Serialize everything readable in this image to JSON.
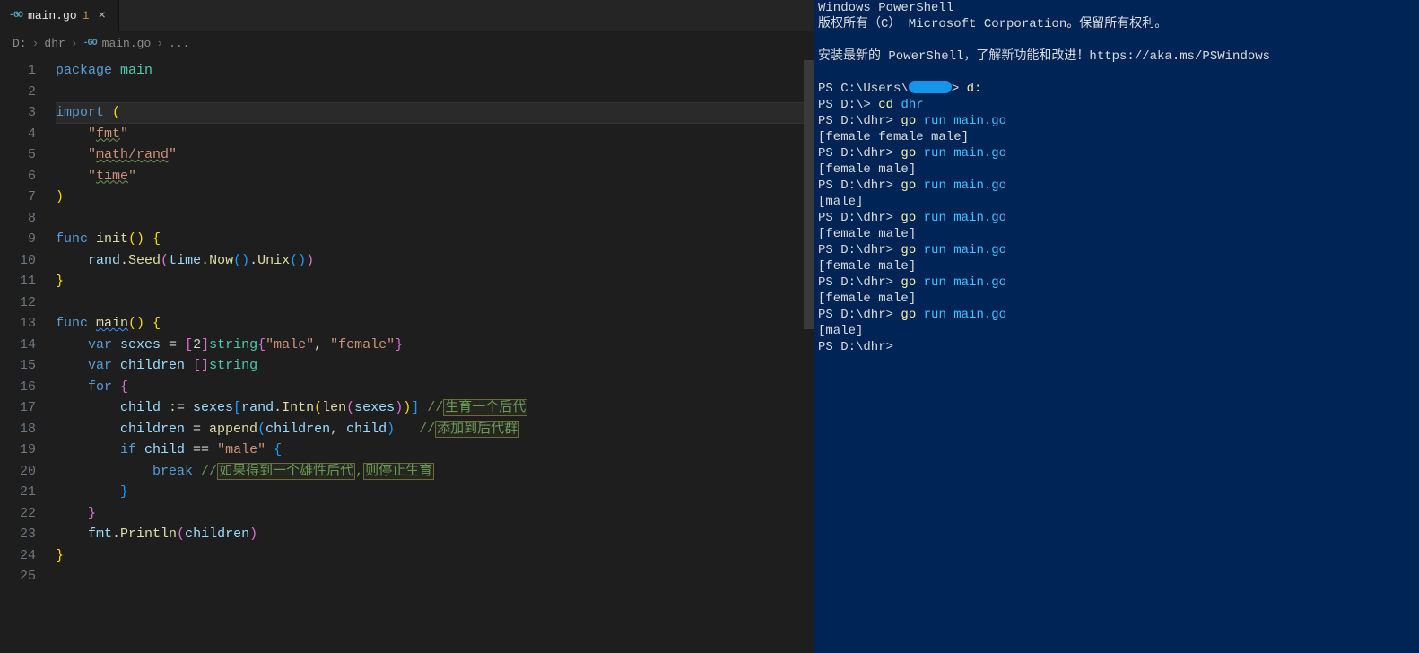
{
  "tab": {
    "filename": "main.go",
    "badge": "1",
    "icon_label": "-GO",
    "close_glyph": "×"
  },
  "breadcrumbs": {
    "parts": [
      "D:",
      "dhr",
      "main.go",
      "..."
    ],
    "sep": "›",
    "go_icon_label": "-GO"
  },
  "editor": {
    "highlight_line_index": 2,
    "lines": [
      [
        {
          "t": "package ",
          "c": "kw"
        },
        {
          "t": "main",
          "c": "ty"
        }
      ],
      [
        {
          "t": "",
          "c": "punc"
        }
      ],
      [
        {
          "t": "import ",
          "c": "kw"
        },
        {
          "t": "(",
          "c": "brk-gold"
        }
      ],
      [
        {
          "t": "    ",
          "c": "punc"
        },
        {
          "t": "\"",
          "c": "str"
        },
        {
          "t": "fmt",
          "c": "str squiggle-grn"
        },
        {
          "t": "\"",
          "c": "str"
        }
      ],
      [
        {
          "t": "    ",
          "c": "punc"
        },
        {
          "t": "\"",
          "c": "str"
        },
        {
          "t": "math/rand",
          "c": "str squiggle-grn"
        },
        {
          "t": "\"",
          "c": "str"
        }
      ],
      [
        {
          "t": "    ",
          "c": "punc"
        },
        {
          "t": "\"",
          "c": "str"
        },
        {
          "t": "time",
          "c": "str squiggle-grn"
        },
        {
          "t": "\"",
          "c": "str"
        }
      ],
      [
        {
          "t": ")",
          "c": "brk-gold"
        }
      ],
      [
        {
          "t": "",
          "c": "punc"
        }
      ],
      [
        {
          "t": "func ",
          "c": "kw"
        },
        {
          "t": "init",
          "c": "fn"
        },
        {
          "t": "() ",
          "c": "brk-gold"
        },
        {
          "t": "{",
          "c": "brk-gold"
        }
      ],
      [
        {
          "t": "    rand",
          "c": "ident"
        },
        {
          "t": ".",
          "c": "punc"
        },
        {
          "t": "Seed",
          "c": "fn"
        },
        {
          "t": "(",
          "c": "brk-pink"
        },
        {
          "t": "time",
          "c": "ident"
        },
        {
          "t": ".",
          "c": "punc"
        },
        {
          "t": "Now",
          "c": "fn"
        },
        {
          "t": "()",
          "c": "brk-blue"
        },
        {
          "t": ".",
          "c": "punc"
        },
        {
          "t": "Unix",
          "c": "fn"
        },
        {
          "t": "()",
          "c": "brk-blue"
        },
        {
          "t": ")",
          "c": "brk-pink"
        }
      ],
      [
        {
          "t": "}",
          "c": "brk-gold"
        }
      ],
      [
        {
          "t": "",
          "c": "punc"
        }
      ],
      [
        {
          "t": "func ",
          "c": "kw"
        },
        {
          "t": "main",
          "c": "fn squiggle"
        },
        {
          "t": "() ",
          "c": "brk-gold"
        },
        {
          "t": "{",
          "c": "brk-gold"
        }
      ],
      [
        {
          "t": "    ",
          "c": "punc"
        },
        {
          "t": "var ",
          "c": "kw"
        },
        {
          "t": "sexes",
          "c": "ident"
        },
        {
          "t": " = ",
          "c": "op"
        },
        {
          "t": "[",
          "c": "brk-pink"
        },
        {
          "t": "2",
          "c": "punc"
        },
        {
          "t": "]",
          "c": "brk-pink"
        },
        {
          "t": "string",
          "c": "ty"
        },
        {
          "t": "{",
          "c": "brk-pink"
        },
        {
          "t": "\"male\"",
          "c": "str"
        },
        {
          "t": ", ",
          "c": "punc"
        },
        {
          "t": "\"female\"",
          "c": "str"
        },
        {
          "t": "}",
          "c": "brk-pink"
        }
      ],
      [
        {
          "t": "    ",
          "c": "punc"
        },
        {
          "t": "var ",
          "c": "kw"
        },
        {
          "t": "children",
          "c": "ident"
        },
        {
          "t": " []",
          "c": "brk-pink"
        },
        {
          "t": "string",
          "c": "ty"
        }
      ],
      [
        {
          "t": "    ",
          "c": "punc"
        },
        {
          "t": "for ",
          "c": "kw"
        },
        {
          "t": "{",
          "c": "brk-pink"
        }
      ],
      [
        {
          "t": "        child",
          "c": "ident"
        },
        {
          "t": " := ",
          "c": "op"
        },
        {
          "t": "sexes",
          "c": "ident"
        },
        {
          "t": "[",
          "c": "brk-blue"
        },
        {
          "t": "rand",
          "c": "ident"
        },
        {
          "t": ".",
          "c": "punc"
        },
        {
          "t": "Intn",
          "c": "fn"
        },
        {
          "t": "(",
          "c": "brk-gold"
        },
        {
          "t": "len",
          "c": "fn"
        },
        {
          "t": "(",
          "c": "brk-pink"
        },
        {
          "t": "sexes",
          "c": "ident"
        },
        {
          "t": ")",
          "c": "brk-pink"
        },
        {
          "t": ")",
          "c": "brk-gold"
        },
        {
          "t": "]",
          "c": "brk-blue"
        },
        {
          "t": " //",
          "c": "cmt"
        },
        {
          "t": "生育一个后代",
          "c": "cmt boxed"
        }
      ],
      [
        {
          "t": "        children",
          "c": "ident"
        },
        {
          "t": " = ",
          "c": "op"
        },
        {
          "t": "append",
          "c": "fn"
        },
        {
          "t": "(",
          "c": "brk-blue"
        },
        {
          "t": "children",
          "c": "ident"
        },
        {
          "t": ", ",
          "c": "punc"
        },
        {
          "t": "child",
          "c": "ident"
        },
        {
          "t": ")",
          "c": "brk-blue"
        },
        {
          "t": "   //",
          "c": "cmt"
        },
        {
          "t": "添加到后代群",
          "c": "cmt boxed"
        }
      ],
      [
        {
          "t": "        ",
          "c": "punc"
        },
        {
          "t": "if ",
          "c": "kw"
        },
        {
          "t": "child",
          "c": "ident"
        },
        {
          "t": " == ",
          "c": "op"
        },
        {
          "t": "\"male\"",
          "c": "str"
        },
        {
          "t": " {",
          "c": "brk-blue"
        }
      ],
      [
        {
          "t": "            ",
          "c": "punc"
        },
        {
          "t": "break ",
          "c": "kw"
        },
        {
          "t": "//",
          "c": "cmt"
        },
        {
          "t": "如果得到一个雄性后代",
          "c": "cmt boxed"
        },
        {
          "t": ",",
          "c": "cmt"
        },
        {
          "t": "则停止生育",
          "c": "cmt boxed"
        }
      ],
      [
        {
          "t": "        }",
          "c": "brk-blue"
        }
      ],
      [
        {
          "t": "    }",
          "c": "brk-pink"
        }
      ],
      [
        {
          "t": "    fmt",
          "c": "ident"
        },
        {
          "t": ".",
          "c": "punc"
        },
        {
          "t": "Println",
          "c": "fn"
        },
        {
          "t": "(",
          "c": "brk-pink"
        },
        {
          "t": "children",
          "c": "ident"
        },
        {
          "t": ")",
          "c": "brk-pink"
        }
      ],
      [
        {
          "t": "}",
          "c": "brk-gold"
        }
      ],
      [
        {
          "t": "",
          "c": "punc"
        }
      ]
    ]
  },
  "terminal": {
    "rows": [
      [
        {
          "t": "Windows PowerShell",
          "c": ""
        }
      ],
      [
        {
          "t": "版权所有（C） Microsoft Corporation。保留所有权利。",
          "c": ""
        }
      ],
      [
        {
          "t": "",
          "c": ""
        }
      ],
      [
        {
          "t": "安装最新的 PowerShell，了解新功能和改进！https://aka.ms/PSWindows",
          "c": ""
        }
      ],
      [
        {
          "t": "",
          "c": ""
        }
      ],
      [
        {
          "t": "PS C:\\Users\\",
          "c": "ps-prompt"
        },
        {
          "redact": true
        },
        {
          "t": "> ",
          "c": "ps-prompt"
        },
        {
          "t": "d:",
          "c": "ps-cmd-yellow"
        }
      ],
      [
        {
          "t": "PS D:\\> ",
          "c": "ps-prompt"
        },
        {
          "t": "cd ",
          "c": "ps-cmd-yellow"
        },
        {
          "t": "dhr",
          "c": "ps-cmd-cyan"
        }
      ],
      [
        {
          "t": "PS D:\\dhr> ",
          "c": "ps-prompt"
        },
        {
          "t": "go ",
          "c": "ps-cmd-yellow"
        },
        {
          "t": "run main.go",
          "c": "ps-cmd-cyan"
        }
      ],
      [
        {
          "t": "[female female male]",
          "c": ""
        }
      ],
      [
        {
          "t": "PS D:\\dhr> ",
          "c": "ps-prompt"
        },
        {
          "t": "go ",
          "c": "ps-cmd-yellow"
        },
        {
          "t": "run main.go",
          "c": "ps-cmd-cyan"
        }
      ],
      [
        {
          "t": "[female male]",
          "c": ""
        }
      ],
      [
        {
          "t": "PS D:\\dhr> ",
          "c": "ps-prompt"
        },
        {
          "t": "go ",
          "c": "ps-cmd-yellow"
        },
        {
          "t": "run main.go",
          "c": "ps-cmd-cyan"
        }
      ],
      [
        {
          "t": "[male]",
          "c": ""
        }
      ],
      [
        {
          "t": "PS D:\\dhr> ",
          "c": "ps-prompt"
        },
        {
          "t": "go ",
          "c": "ps-cmd-yellow"
        },
        {
          "t": "run main.go",
          "c": "ps-cmd-cyan"
        }
      ],
      [
        {
          "t": "[female male]",
          "c": ""
        }
      ],
      [
        {
          "t": "PS D:\\dhr> ",
          "c": "ps-prompt"
        },
        {
          "t": "go ",
          "c": "ps-cmd-yellow"
        },
        {
          "t": "run main.go",
          "c": "ps-cmd-cyan"
        }
      ],
      [
        {
          "t": "[female male]",
          "c": ""
        }
      ],
      [
        {
          "t": "PS D:\\dhr> ",
          "c": "ps-prompt"
        },
        {
          "t": "go ",
          "c": "ps-cmd-yellow"
        },
        {
          "t": "run main.go",
          "c": "ps-cmd-cyan"
        }
      ],
      [
        {
          "t": "[female male]",
          "c": ""
        }
      ],
      [
        {
          "t": "PS D:\\dhr> ",
          "c": "ps-prompt"
        },
        {
          "t": "go ",
          "c": "ps-cmd-yellow"
        },
        {
          "t": "run main.go",
          "c": "ps-cmd-cyan"
        }
      ],
      [
        {
          "t": "[male]",
          "c": ""
        }
      ],
      [
        {
          "t": "PS D:\\dhr>",
          "c": "ps-prompt"
        }
      ]
    ]
  }
}
